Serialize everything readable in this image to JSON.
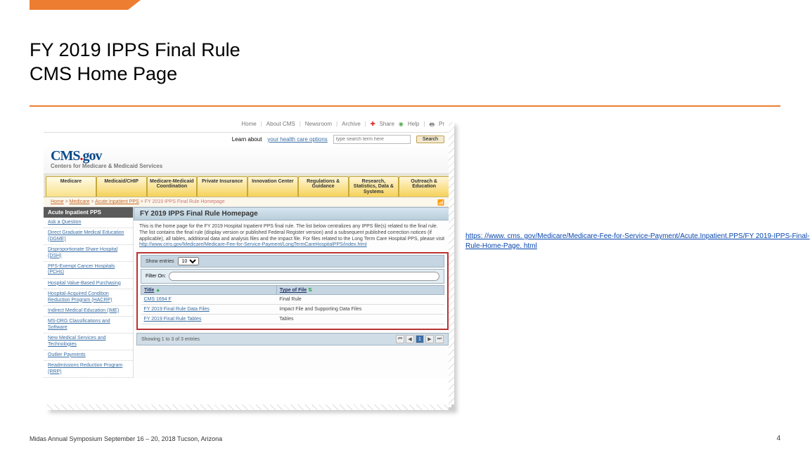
{
  "slide": {
    "title_line1": "FY 2019 IPPS Final Rule",
    "title_line2": "CMS Home Page",
    "footer": "Midas Annual Symposium  September 16 – 20, 2018   Tucson, Arizona",
    "page_number": "4"
  },
  "link_url": "https: //www. cms. gov/Medicare/Medicare-Fee-for-Service-Payment/Acute.Inpatient.PPS/FY 2019-IPPS-Final-Rule-Home-Page. html",
  "cms": {
    "util": {
      "home": "Home",
      "about": "About CMS",
      "news": "Newsroom",
      "archive": "Archive",
      "share": "Share",
      "help": "Help",
      "print": "Pr"
    },
    "learn": {
      "prefix": "Learn about",
      "link": "your health care options",
      "search_ph": "type search term here",
      "search_btn": "Search"
    },
    "logo": "CMS.gov",
    "logo_sub": "Centers for Medicare & Medicaid Services",
    "tabs": [
      "Medicare",
      "Medicaid/CHIP",
      "Medicare-Medicaid Coordination",
      "Private Insurance",
      "Innovation Center",
      "Regulations & Guidance",
      "Research, Statistics, Data & Systems",
      "Outreach & Education"
    ],
    "breadcrumb": {
      "a": "Home",
      "b": "Medicare",
      "c": "Acute Inpatient PPS",
      "d": "FY 2019 IPPS Final Rule Homepage",
      "rss": "RSS"
    },
    "sidebar": {
      "header": "Acute Inpatient PPS",
      "items": [
        "Ask a Question",
        "Direct Graduate Medical Education (DGME)",
        "Disproportionate Share Hospital (DSH)",
        "PPS-Exempt Cancer Hospitals (PCHs)",
        "Hospital Value-Based Purchasing",
        "Hospital-Acquired Condition Reduction Program (HACRP)",
        "Indirect Medical Education (IME)",
        "MS-DRG Classifications and Software",
        "New Medical Services and Technologies",
        "Outlier Payments",
        "Readmissions Reduction Program (RRP)"
      ]
    },
    "main": {
      "heading": "FY 2019 IPPS Final Rule Homepage",
      "body": "This is the home page for the FY 2019 Hospital Inpatient PPS final rule. The list below centralizes any IPPS file(s) related to the final rule. The list contains the final rule (display version or published Federal Register version) and a subsequent published correction notices (if applicable), all tables, additional data and analysis files and the impact file. For files related to the Long Term Care Hospital PPS, please visit ",
      "body_link": "http://www.cms.gov/Medicare/Medicare-Fee-for-Service-Payment/LongTermCareHospitalPPS/index.html",
      "show_entries": "Show entries",
      "filter_on": "Filter On:",
      "th1": "Title",
      "th2": "Type of File",
      "rows": [
        {
          "t": "CMS 1694 F",
          "f": "Final Rule"
        },
        {
          "t": "FY 2019 Final Rule Data Files",
          "f": "Impact File and Supporting Data Files"
        },
        {
          "t": "FY 2019 Final Rule Tables",
          "f": "Tables"
        }
      ],
      "showing": "Showing 1 to 3 of 3 entries",
      "page_cur": "1"
    }
  }
}
